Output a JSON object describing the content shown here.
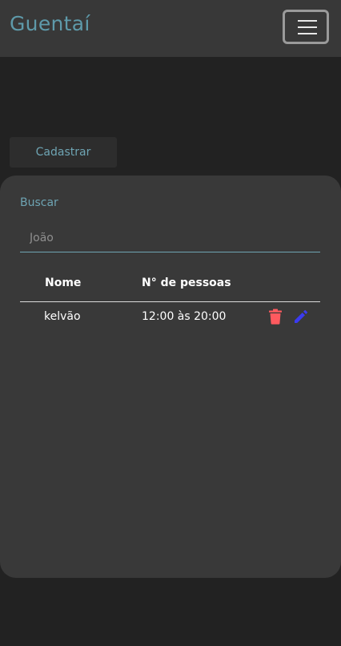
{
  "navbar": {
    "brand": "Guentaí"
  },
  "actions": {
    "register_label": "Cadastrar"
  },
  "search": {
    "label": "Buscar",
    "placeholder": "João",
    "value": ""
  },
  "table": {
    "columns": [
      "Nome",
      "N° de pessoas"
    ],
    "rows": [
      {
        "name": "kelvão",
        "time": "12:00 às 20:00"
      }
    ]
  },
  "colors": {
    "brand": "#5e9aaa",
    "delete_icon": "#ff5a5f",
    "edit_icon": "#3b3bf0"
  },
  "icons": {
    "delete": "trash-icon",
    "edit": "pencil-icon",
    "menu": "hamburger-icon"
  }
}
